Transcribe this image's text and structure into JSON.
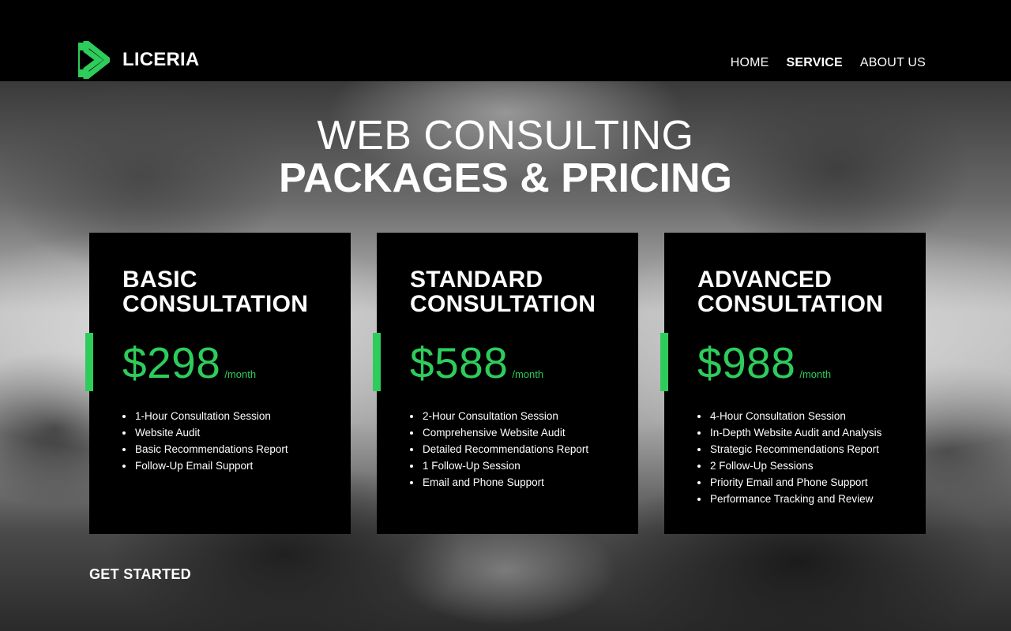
{
  "brand": {
    "name": "LICERIA",
    "accent_color": "#2ecc5b",
    "logo_icon": "liceria-logo-icon"
  },
  "nav": {
    "items": [
      {
        "label": "HOME",
        "active": false
      },
      {
        "label": "SERVICE",
        "active": true
      },
      {
        "label": "ABOUT US",
        "active": false
      }
    ]
  },
  "hero": {
    "line1": "WEB CONSULTING",
    "line2": "PACKAGES & PRICING"
  },
  "plans": [
    {
      "title_line1": "BASIC",
      "title_line2": "CONSULTATION",
      "price": "$298",
      "period": "/month",
      "features": [
        "1-Hour Consultation Session",
        "Website Audit",
        "Basic Recommendations Report",
        "Follow-Up Email Support"
      ]
    },
    {
      "title_line1": "STANDARD",
      "title_line2": "CONSULTATION",
      "price": "$588",
      "period": "/month",
      "features": [
        "2-Hour Consultation Session",
        "Comprehensive Website Audit",
        "Detailed Recommendations Report",
        "1 Follow-Up Session",
        "Email and Phone Support"
      ]
    },
    {
      "title_line1": "ADVANCED",
      "title_line2": "CONSULTATION",
      "price": "$988",
      "period": "/month",
      "features": [
        "4-Hour Consultation Session",
        "In-Depth Website Audit and Analysis",
        "Strategic Recommendations Report",
        "2 Follow-Up Sessions",
        "Priority Email and Phone Support",
        "Performance Tracking and Review"
      ]
    }
  ],
  "cta": {
    "label": "GET STARTED"
  }
}
